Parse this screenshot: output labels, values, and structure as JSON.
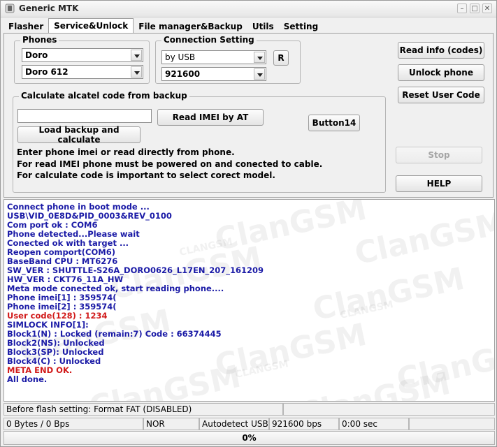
{
  "window": {
    "title": "Generic MTK",
    "minimize": "–",
    "restore": "□",
    "close": "✕"
  },
  "tabs": [
    "Flasher",
    "Service&Unlock",
    "File manager&Backup",
    "Utils",
    "Setting"
  ],
  "active_tab": 1,
  "phones": {
    "label": "Phones",
    "brand": "Doro",
    "model": "Doro 612"
  },
  "connection": {
    "label": "Connection Setting",
    "port": "by USB",
    "baud": "921600",
    "refresh_label": "R"
  },
  "alcatel": {
    "label": "Calculate alcatel code from backup",
    "input_value": "",
    "read_imei_label": "Read IMEI by AT",
    "button14_label": "Button14",
    "load_backup_label": "Load backup and calculate",
    "info": [
      "Enter phone imei or read directly from phone.",
      "For read IMEI phone must be powered on and conected to cable.",
      "For calculate code is important to select corect model."
    ]
  },
  "side_buttons": {
    "read_info": "Read info (codes)",
    "unlock_phone": "Unlock phone",
    "reset_user_code": "Reset User Code",
    "stop": "Stop",
    "help": "HELP"
  },
  "watermark_text": "ClanGSM",
  "watermark_small": "CLANGSM",
  "log": [
    {
      "text": "Connect phone in boot mode ...",
      "color": "#1a1aa6"
    },
    {
      "text": "USB\\VID_0E8D&PID_0003&REV_0100",
      "color": "#1a1aa6"
    },
    {
      "text": "Com port ok : COM6",
      "color": "#1a1aa6"
    },
    {
      "text": "Phone detected...Please wait",
      "color": "#1a1aa6"
    },
    {
      "text": "Conected ok with target ...",
      "color": "#1a1aa6"
    },
    {
      "text": "Reopen comport(COM6)",
      "color": "#1a1aa6"
    },
    {
      "text": "BaseBand CPU : MT6276",
      "color": "#1a1aa6"
    },
    {
      "text": "SW_VER : SHUTTLE-S26A_DORO0626_L17EN_207_161209",
      "color": "#1a1aa6"
    },
    {
      "text": "HW_VER : CKT76_11A_HW",
      "color": "#1a1aa6"
    },
    {
      "text": "Meta mode conected ok, start reading phone....",
      "color": "#1a1aa6"
    },
    {
      "text": "Phone imei[1] : 359574(",
      "color": "#1a1aa6"
    },
    {
      "text": "Phone imei[2] : 359574(",
      "color": "#1a1aa6"
    },
    {
      "text": "User code(128) : 1234",
      "color": "#d11a1a"
    },
    {
      "text": "SIMLOCK INFO[1]:",
      "color": "#1a1aa6"
    },
    {
      "text": "Block1(N)  : Locked (remain:7) Code : 66374445",
      "color": "#1a1aa6"
    },
    {
      "text": "Block2(NS): Unlocked",
      "color": "#1a1aa6"
    },
    {
      "text": "Block3(SP): Unlocked",
      "color": "#1a1aa6"
    },
    {
      "text": "Block4(C)  : Unlocked",
      "color": "#1a1aa6"
    },
    {
      "text": "META END OK.",
      "color": "#d11a1a"
    },
    {
      "text": "All done.",
      "color": "#1a1aa6"
    }
  ],
  "status1": {
    "flash_setting": "Before flash setting: Format FAT (DISABLED)",
    "extra": ""
  },
  "status2": {
    "transfer": "0 Bytes / 0 Bps",
    "storage": "NOR",
    "connection": "Autodetect USB",
    "baud": "921600 bps",
    "time": "0:00 sec",
    "extra": ""
  },
  "progress": {
    "value": 0,
    "label": "0%"
  }
}
